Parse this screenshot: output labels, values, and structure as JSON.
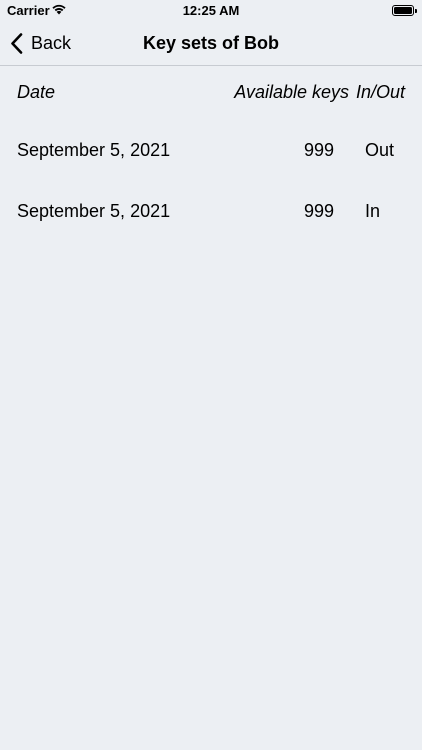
{
  "status_bar": {
    "carrier": "Carrier",
    "time": "12:25 AM"
  },
  "nav": {
    "back_label": "Back",
    "title": "Key sets of Bob"
  },
  "table": {
    "headers": {
      "date": "Date",
      "available_keys": "Available keys",
      "in_out": "In/Out"
    },
    "rows": [
      {
        "date": "September 5, 2021",
        "available_keys": "999",
        "in_out": "Out"
      },
      {
        "date": "September 5, 2021",
        "available_keys": "999",
        "in_out": "In"
      }
    ]
  },
  "colors": {
    "background": "#eceff3",
    "separator": "#c7cbd1",
    "text": "#000000"
  },
  "icons": {
    "wifi": "wifi-icon",
    "battery": "battery-icon",
    "back": "chevron-left-icon"
  }
}
